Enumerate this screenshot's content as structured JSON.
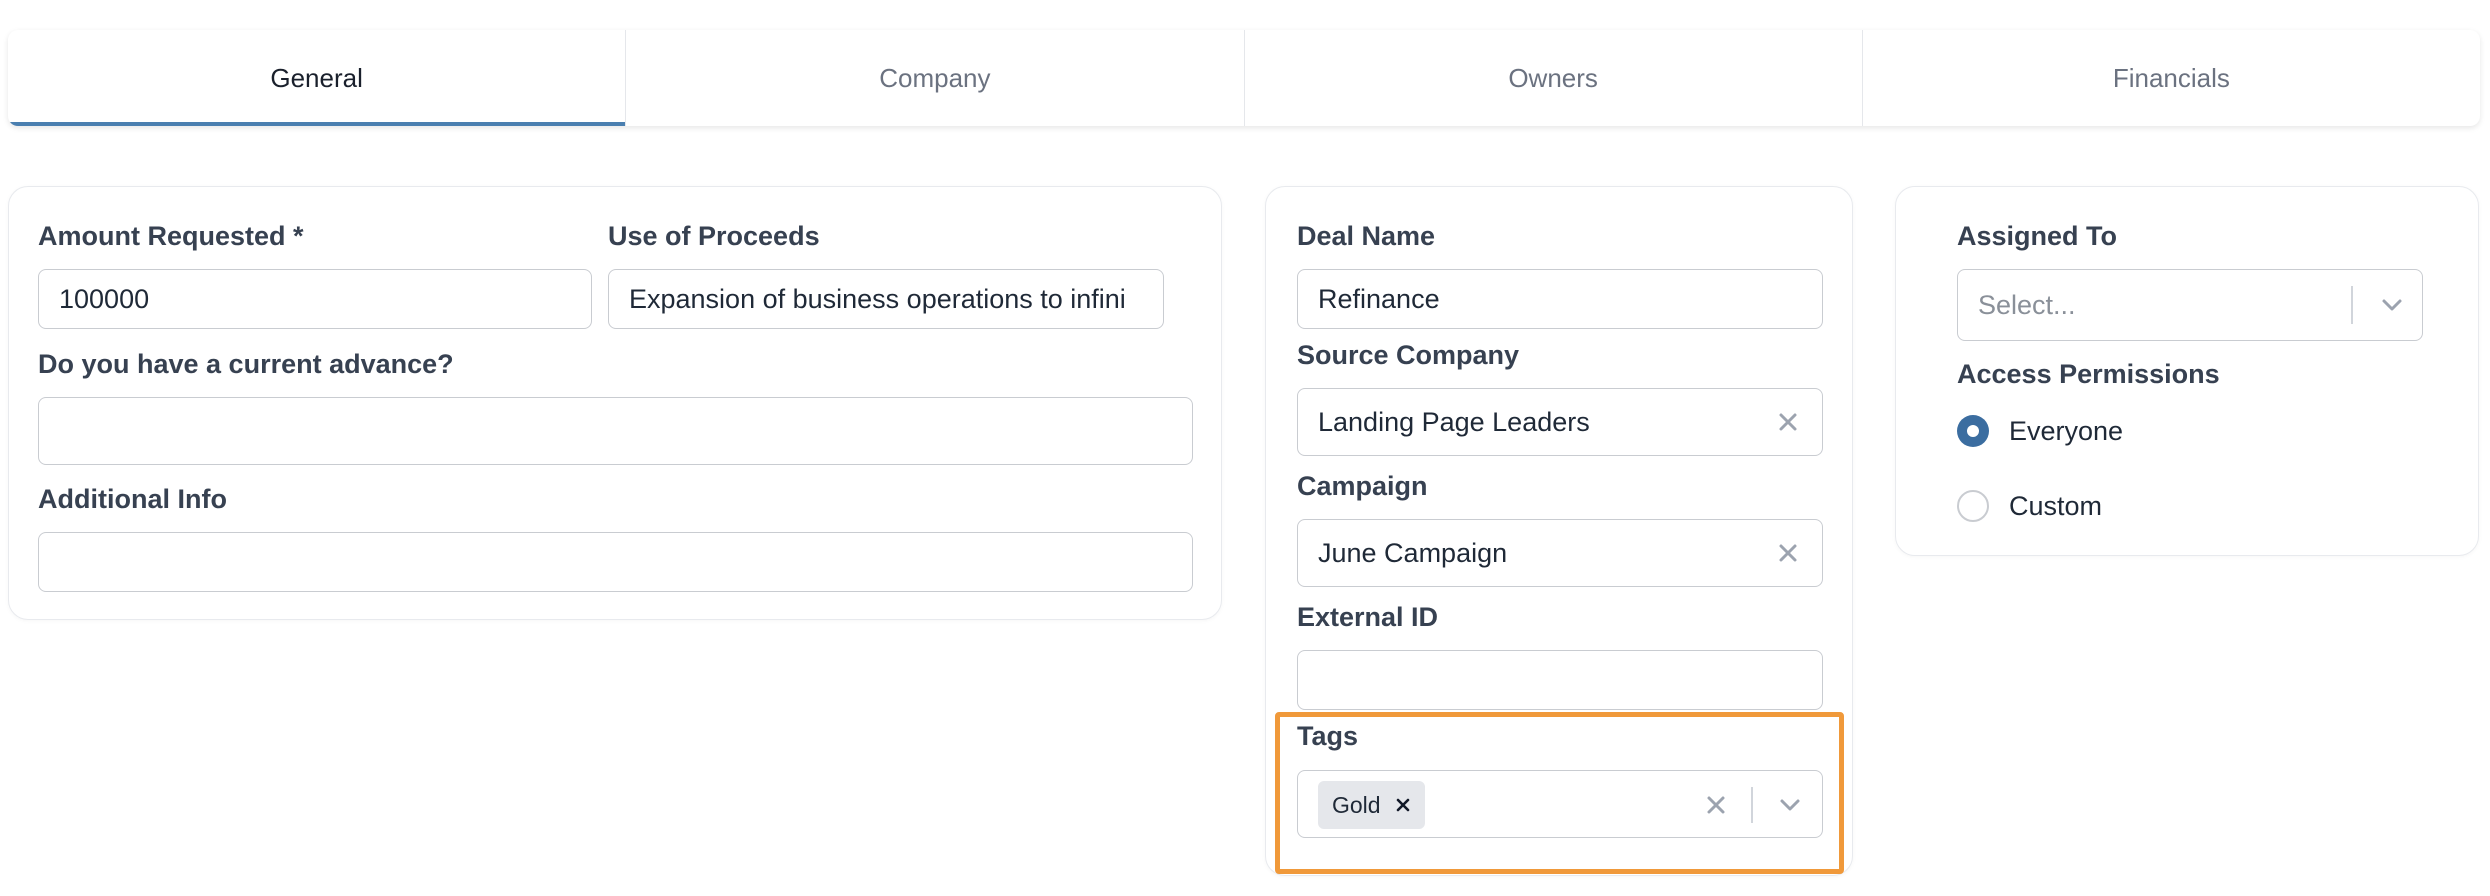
{
  "tabs": [
    {
      "label": "General",
      "active": true
    },
    {
      "label": "Company",
      "active": false
    },
    {
      "label": "Owners",
      "active": false
    },
    {
      "label": "Financials",
      "active": false
    }
  ],
  "general": {
    "amount_label": "Amount Requested *",
    "amount_value": "100000",
    "proceeds_label": "Use of Proceeds",
    "proceeds_value": "Expansion of business operations to infini",
    "advance_label": "Do you have a current advance?",
    "advance_value": "",
    "additional_label": "Additional Info",
    "additional_value": ""
  },
  "deal": {
    "name_label": "Deal Name",
    "name_value": "Refinance",
    "source_label": "Source Company",
    "source_value": "Landing Page Leaders",
    "campaign_label": "Campaign",
    "campaign_value": "June Campaign",
    "external_label": "External ID",
    "external_value": "",
    "tags_label": "Tags",
    "tags": [
      "Gold"
    ]
  },
  "assignment": {
    "assigned_label": "Assigned To",
    "assigned_placeholder": "Select...",
    "access_label": "Access Permissions",
    "options": [
      {
        "label": "Everyone",
        "selected": true
      },
      {
        "label": "Custom",
        "selected": false
      }
    ]
  },
  "colors": {
    "accent": "#3b6da0",
    "active_tab_underline": "#4a7fb0",
    "highlight": "#f0993a"
  }
}
